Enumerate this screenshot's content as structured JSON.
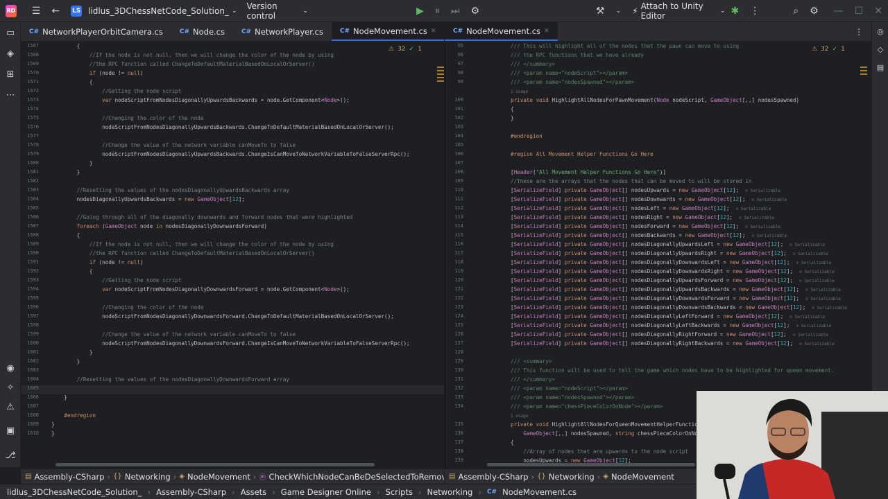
{
  "topbar": {
    "logo": "RD",
    "project_badge": "LS",
    "project": "lidlus_3DChessNetCode_Solution_",
    "vcs": "Version control",
    "attach": "Attach to Unity Editor"
  },
  "left_tabs": [
    {
      "label": "NetworkPlayerOrbitCamera.cs"
    },
    {
      "label": "Node.cs"
    },
    {
      "label": "NetworkPlayer.cs"
    },
    {
      "label": "NodeMovement.cs"
    }
  ],
  "right_tabs": [
    {
      "label": "NodeMovement.cs"
    }
  ],
  "inspections": {
    "warnings": "32",
    "weak": "1"
  },
  "left_editor": {
    "line_numbers": [
      "1567",
      "1568",
      "1569",
      "1570",
      "1571",
      "1572",
      "1573",
      "1574",
      "1575",
      "1576",
      "1577",
      "1578",
      "1579",
      "1580",
      "1581",
      "1582",
      "1583",
      "1584",
      "1585",
      "1586",
      "1587",
      "1588",
      "1589",
      "1590",
      "1591",
      "1592",
      "1593",
      "1594",
      "1595",
      "1596",
      "1597",
      "1598",
      "1599",
      "1600",
      "1601",
      "1602",
      "1603",
      "1604",
      "1605",
      "1606",
      "1607",
      "1608",
      "1609",
      "1610"
    ],
    "lines": [
      "        {",
      "            //If the node is not null, then we will change the color of the node by using",
      "            //the RPC function called ChangeToDefaultMaterialBasedOnLocalOrServer()",
      "            if (node != null)",
      "            {",
      "                //Getting the node script",
      "                var nodeScriptFromNodesDiagonallyUpwardsBackwards = node.GetComponent<Node>();",
      "",
      "                //Changing the color of the node",
      "                nodeScriptFromNodesDiagonallyUpwardsBackwards.ChangeToDefaultMaterialBasedOnLocalOrServer();",
      "",
      "                //Change the value of the network variable canMoveTo to false",
      "                nodeScriptFromNodesDiagonallyUpwardsBackwards.ChangeIsCanMoveToNetworkVariableToFalseServerRpc();",
      "            }",
      "        }",
      "",
      "        //Resetting the values of the nodesDiagonallyUpwardsBackwards array",
      "        nodesDiagonallyUpwardsBackwards = new GameObject[12];",
      "",
      "        //Going through all of the diagonally downwards and forward nodes that were highlighted",
      "        foreach (GameObject node in nodesDiagonallyDownwardsForward)",
      "        {",
      "            //If the node is not null, then we will change the color of the node by using",
      "            //the RPC function called ChangeToDefaultMaterialBasedOnLocalOrServer()",
      "            if (node != null)",
      "            {",
      "                //Getting the node script",
      "                var nodeScriptFromNodesDiagonallyDownwardsForward = node.GetComponent<Node>();",
      "",
      "                //Changing the color of the node",
      "                nodeScriptFromNodesDiagonallyDownwardsForward.ChangeToDefaultMaterialBasedOnLocalOrServer();",
      "",
      "                //Change the value of the network variable canMoveTo to false",
      "                nodeScriptFromNodesDiagonallyDownwardsForward.ChangeIsCanMoveToNetworkVariableToFalseServerRpc();",
      "            }",
      "        }",
      "",
      "        //Resetting the values of the nodesDiagonallyDownwardsForward array",
      "",
      "    }",
      "",
      "    #endregion",
      "}",
      "}"
    ]
  },
  "right_editor": {
    "line_numbers": [
      "95",
      "96",
      "97",
      "98",
      "99",
      "",
      "100",
      "101",
      "102",
      "103",
      "104",
      "105",
      "106",
      "107",
      "108",
      "109",
      "110",
      "111",
      "112",
      "113",
      "114",
      "115",
      "116",
      "117",
      "118",
      "119",
      "120",
      "121",
      "122",
      "123",
      "124",
      "125",
      "126",
      "127",
      "128",
      "129",
      "130",
      "131",
      "132",
      "133",
      "134",
      "",
      "135",
      "136",
      "137",
      "138",
      "139"
    ],
    "lines": [
      "/// This will highlight all of the nodes that the pawn can move to using",
      "/// the RPC functions that we have already",
      "/// </summary>",
      "/// <param name=\"nodeScript\"></param>",
      "/// <param name=\"nodesSpawned\"></param>",
      "1 usage",
      "private void HighlightAllNodesForPawnMovement(Node nodeScript, GameObject[,,] nodesSpawned)",
      "{",
      "}",
      "",
      "#endregion",
      "",
      "#region All Movement Helper Functions Go Here",
      "",
      "[Header(\"All Movement Helper Functions Go Here\")]",
      "//These are the arrays that the nodes that can be moved to will be stored in",
      "[SerializeField] private GameObject[] nodesUpwards = new GameObject[12];",
      "[SerializeField] private GameObject[] nodesDownwards = new GameObject[12];",
      "[SerializeField] private GameObject[] nodesLeft = new GameObject[12];",
      "[SerializeField] private GameObject[] nodesRight = new GameObject[12];",
      "[SerializeField] private GameObject[] nodesForward = new GameObject[12];",
      "[SerializeField] private GameObject[] nodesBackwards = new GameObject[12];",
      "[SerializeField] private GameObject[] nodesDiagonallyUpwardsLeft = new GameObject[12];",
      "[SerializeField] private GameObject[] nodesDiagonallyUpwardsRight = new GameObject[12];",
      "[SerializeField] private GameObject[] nodesDiagonallyDownwardsLeft = new GameObject[12];",
      "[SerializeField] private GameObject[] nodesDiagonallyDownwardsRight = new GameObject[12];",
      "[SerializeField] private GameObject[] nodesDiagonallyUpwardsForward = new GameObject[12];",
      "[SerializeField] private GameObject[] nodesDiagonallyUpwardsBackwards = new GameObject[12];",
      "[SerializeField] private GameObject[] nodesDiagonallyDownwardsForward = new GameObject[12];",
      "[SerializeField] private GameObject[] nodesDiagonallyDownwardsBackwards = new GameObject[12];",
      "[SerializeField] private GameObject[] nodesDiagonallyLeftForward = new GameObject[12];",
      "[SerializeField] private GameObject[] nodesDiagonallyLeftBackwards = new GameObject[12];",
      "[SerializeField] private GameObject[] nodesDiagonallyRightForward = new GameObject[12];",
      "[SerializeField] private GameObject[] nodesDiagonallyRightBackwards = new GameObject[12];",
      "",
      "/// <summary>",
      "/// This function will be used to tell the game which nodes have to be highlighted for queen movement.",
      "/// </summary>",
      "/// <param name=\"nodeScript\"></param>",
      "/// <param name=\"nodesSpawned\"></param>",
      "/// <param name=\"chessPieceColorOnNode\"></param>",
      "1 usage",
      "private void HighlightAllNodesForQueenMovementHelperFunction(Node nodeScript,",
      "    GameObject[,,] nodesSpawned, string chessPieceColorOnNode",
      "{",
      "    //Array of nodes that are upwards to the node script",
      "    nodesUpwards = new GameObject[12];"
    ]
  },
  "serializable_hint": "Serializable",
  "left_breadcrumb": [
    "Assembly-CSharp",
    "Networking",
    "NodeMovement",
    "CheckWhichNodeCanBeDeSelectedToRemoveNod"
  ],
  "right_breadcrumb": [
    "Assembly-CSharp",
    "Networking",
    "NodeMovement"
  ],
  "status": [
    "lidlus_3DChessNetCode_Solution_",
    "Assembly-CSharp",
    "Assets",
    "Game Designer Online",
    "Scripts",
    "Networking",
    "NodeMovement.cs"
  ],
  "colors": {
    "accent": "#3574f0",
    "bg": "#1e1f22",
    "panel": "#2b2d30"
  }
}
